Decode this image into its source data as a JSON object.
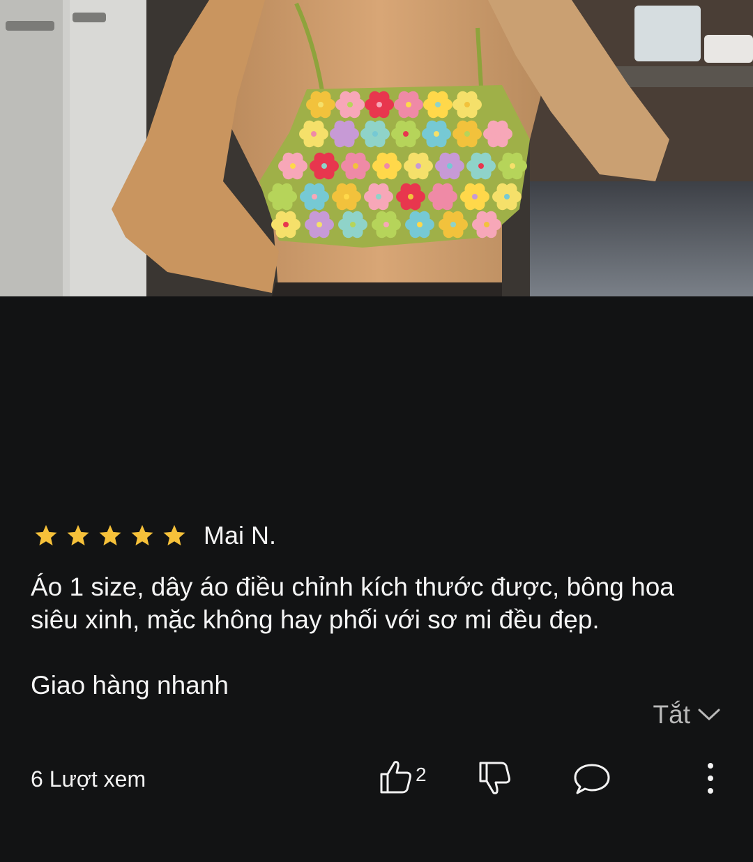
{
  "photo": {
    "icon": "product-photo-crochet-flower-top"
  },
  "review": {
    "rating": 5,
    "rating_max": 5,
    "star_color": "#F6C13A",
    "reviewer": "Mai N.",
    "body": "Áo 1 size, dây áo điều chỉnh kích thước được, bông hoa\nsiêu xinh, mặc không hay phối với sơ mi đều đẹp.\n\nGiao hàng nhanh",
    "toggle_label": "Tắt"
  },
  "footer": {
    "views_label": "6 Lượt xem",
    "like_count": "2"
  }
}
